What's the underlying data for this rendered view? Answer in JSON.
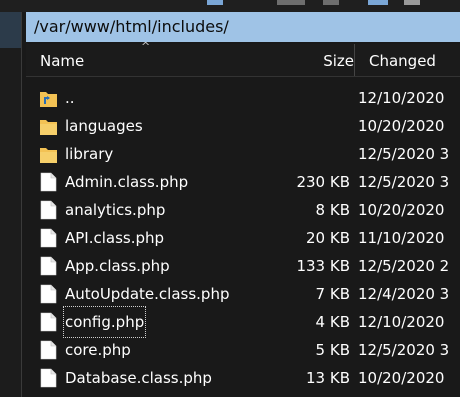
{
  "path": "/var/www/html/includes/",
  "columns": {
    "name": "Name",
    "size": "Size",
    "changed": "Changed"
  },
  "rows": [
    {
      "name": "..",
      "size": "",
      "changed": "12/10/2020",
      "type": "parent-dir"
    },
    {
      "name": "languages",
      "size": "",
      "changed": "10/20/2020",
      "type": "folder"
    },
    {
      "name": "library",
      "size": "",
      "changed": "12/5/2020 3",
      "type": "folder"
    },
    {
      "name": "Admin.class.php",
      "size": "230 KB",
      "changed": "12/5/2020 3",
      "type": "file"
    },
    {
      "name": "analytics.php",
      "size": "8 KB",
      "changed": "10/20/2020",
      "type": "file"
    },
    {
      "name": "API.class.php",
      "size": "20 KB",
      "changed": "11/10/2020",
      "type": "file"
    },
    {
      "name": "App.class.php",
      "size": "133 KB",
      "changed": "12/5/2020 2",
      "type": "file"
    },
    {
      "name": "AutoUpdate.class.php",
      "size": "7 KB",
      "changed": "12/4/2020 3",
      "type": "file"
    },
    {
      "name": "config.php",
      "size": "4 KB",
      "changed": "12/10/2020",
      "type": "file"
    },
    {
      "name": "core.php",
      "size": "5 KB",
      "changed": "12/5/2020 3",
      "type": "file"
    },
    {
      "name": "Database.class.php",
      "size": "13 KB",
      "changed": "10/20/2020",
      "type": "file"
    }
  ],
  "colors": {
    "path_bar": "#9fc3e6",
    "folder": "#f3c254",
    "background": "#191919"
  },
  "icons": {
    "parent": "parent-folder-icon",
    "folder": "folder-icon",
    "file": "file-icon"
  }
}
